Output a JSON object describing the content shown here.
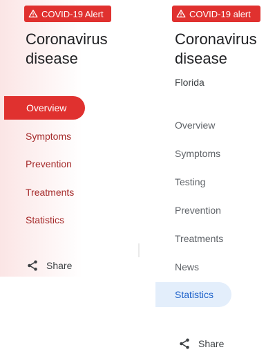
{
  "left": {
    "alert": {
      "label": "COVID-19 Alert",
      "icon": "warning-icon"
    },
    "title": [
      "Coronavirus",
      "disease"
    ],
    "nav": [
      {
        "label": "Overview",
        "active": true
      },
      {
        "label": "Symptoms",
        "active": false
      },
      {
        "label": "Prevention",
        "active": false
      },
      {
        "label": "Treatments",
        "active": false
      },
      {
        "label": "Statistics",
        "active": false
      }
    ],
    "share": {
      "label": "Share",
      "icon": "share-icon"
    }
  },
  "right": {
    "alert": {
      "label": "COVID-19 alert",
      "icon": "warning-icon"
    },
    "title": [
      "Coronavirus",
      "disease"
    ],
    "subtitle": "Florida",
    "nav": [
      {
        "label": "Overview",
        "active": false
      },
      {
        "label": "Symptoms",
        "active": false
      },
      {
        "label": "Testing",
        "active": false
      },
      {
        "label": "Prevention",
        "active": false
      },
      {
        "label": "Treatments",
        "active": false
      },
      {
        "label": "News",
        "active": false
      },
      {
        "label": "Statistics",
        "active": true
      }
    ],
    "share": {
      "label": "Share",
      "icon": "share-icon"
    }
  },
  "colors": {
    "alert_red": "#e0312f",
    "left_nav_text": "#a52a2a",
    "right_active_bg": "#e3eefb",
    "right_active_text": "#1a5fc9"
  }
}
